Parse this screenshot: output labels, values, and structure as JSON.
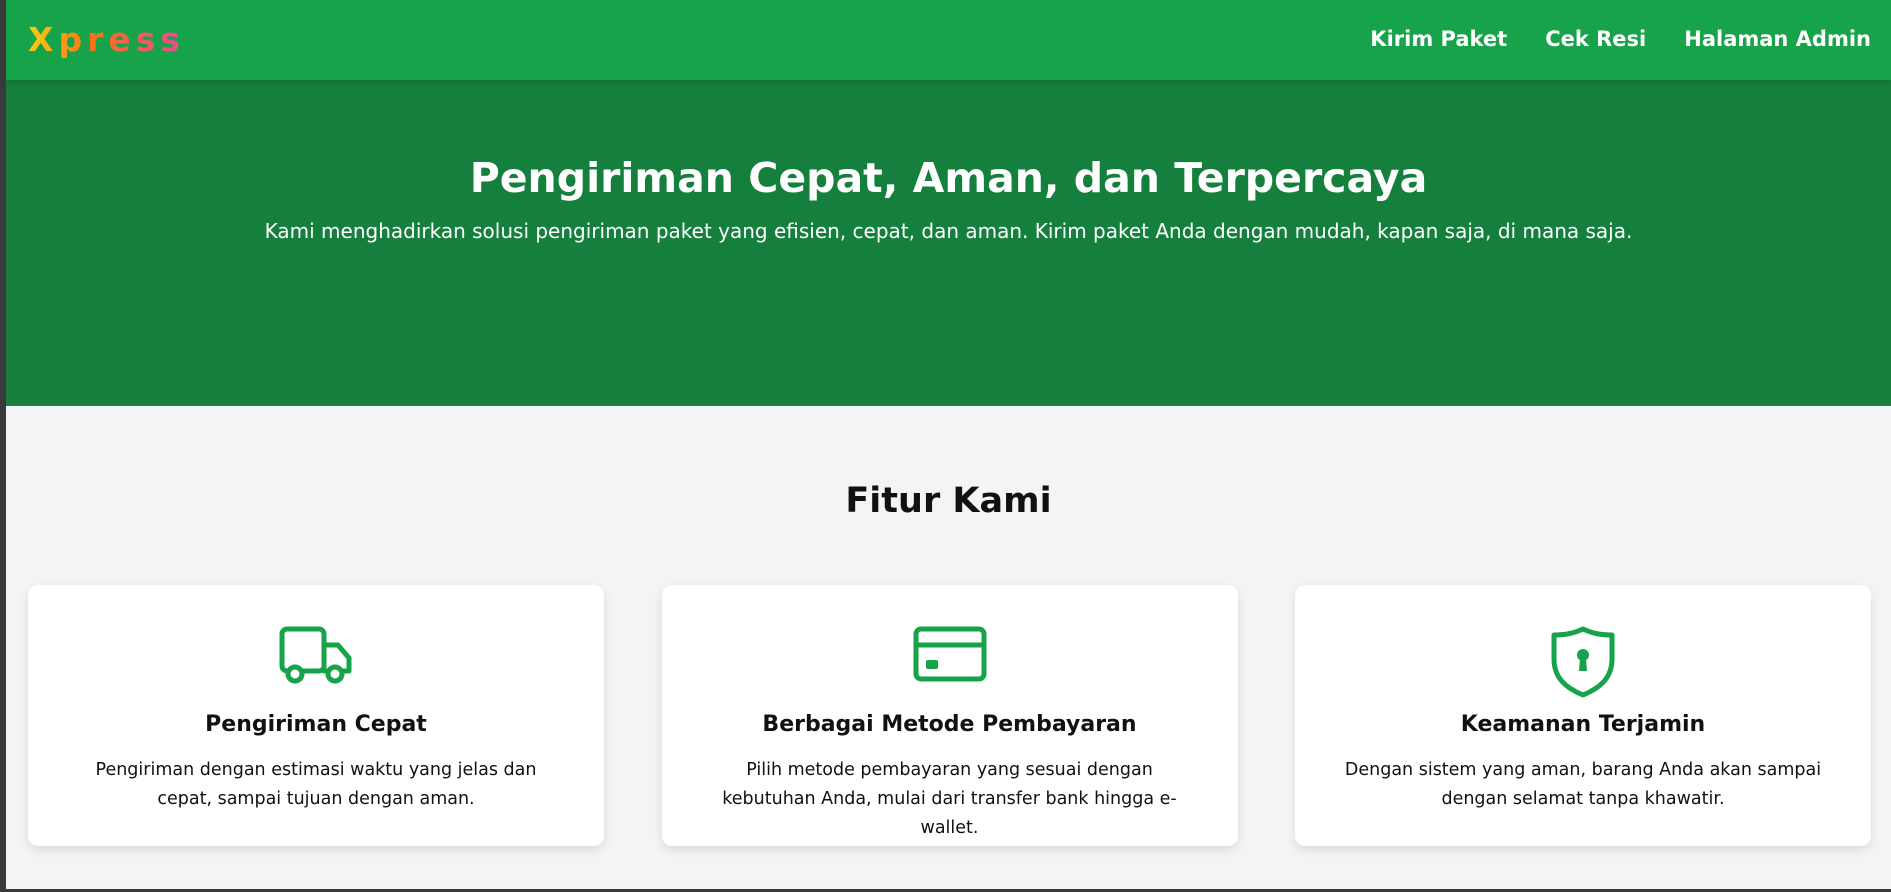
{
  "brand": {
    "logo_text": "Xpress",
    "primary_color": "#16a34a",
    "hero_color": "#15803d",
    "icon_color": "#16a34a"
  },
  "nav": {
    "items": [
      {
        "label": "Kirim Paket"
      },
      {
        "label": "Cek Resi"
      },
      {
        "label": "Halaman Admin"
      }
    ]
  },
  "hero": {
    "title": "Pengiriman Cepat, Aman, dan Terpercaya",
    "subtitle": "Kami menghadirkan solusi pengiriman paket yang efisien, cepat, dan aman. Kirim paket Anda dengan mudah, kapan saja, di mana saja."
  },
  "features": {
    "title": "Fitur Kami",
    "cards": [
      {
        "icon": "truck-icon",
        "title": "Pengiriman Cepat",
        "text": "Pengiriman dengan estimasi waktu yang jelas dan cepat, sampai tujuan dengan aman."
      },
      {
        "icon": "credit-card-icon",
        "title": "Berbagai Metode Pembayaran",
        "text": "Pilih metode pembayaran yang sesuai dengan kebutuhan Anda, mulai dari transfer bank hingga e-wallet."
      },
      {
        "icon": "shield-lock-icon",
        "title": "Keamanan Terjamin",
        "text": "Dengan sistem yang aman, barang Anda akan sampai dengan selamat tanpa khawatir."
      }
    ]
  }
}
